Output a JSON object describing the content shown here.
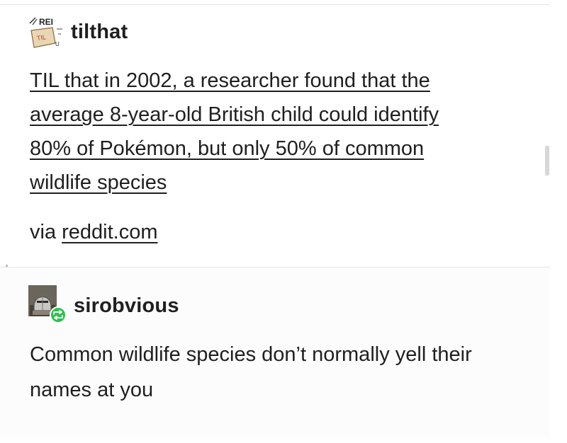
{
  "post": {
    "username": "tilthat",
    "avatar_icon": "til-sign-avatar-icon",
    "avatar_text": "REI",
    "text_lines": [
      "TIL that in 2002, a researcher found that the",
      "average 8-year-old British child could identify",
      "80% of Pokémon, but only 50% of common",
      "wildlife species"
    ],
    "via_prefix": "via ",
    "via_link": "reddit.com"
  },
  "reply": {
    "username": "sirobvious",
    "avatar_icon": "knight-helmet-avatar-icon",
    "reblog_icon": "reblog-icon",
    "text_lines": [
      "Common wildlife species don’t normally yell their",
      "names at you"
    ]
  },
  "colors": {
    "text": "#1f1f1f",
    "reblog_badge": "#2fbf4e",
    "divider": "#e6e6e6"
  }
}
